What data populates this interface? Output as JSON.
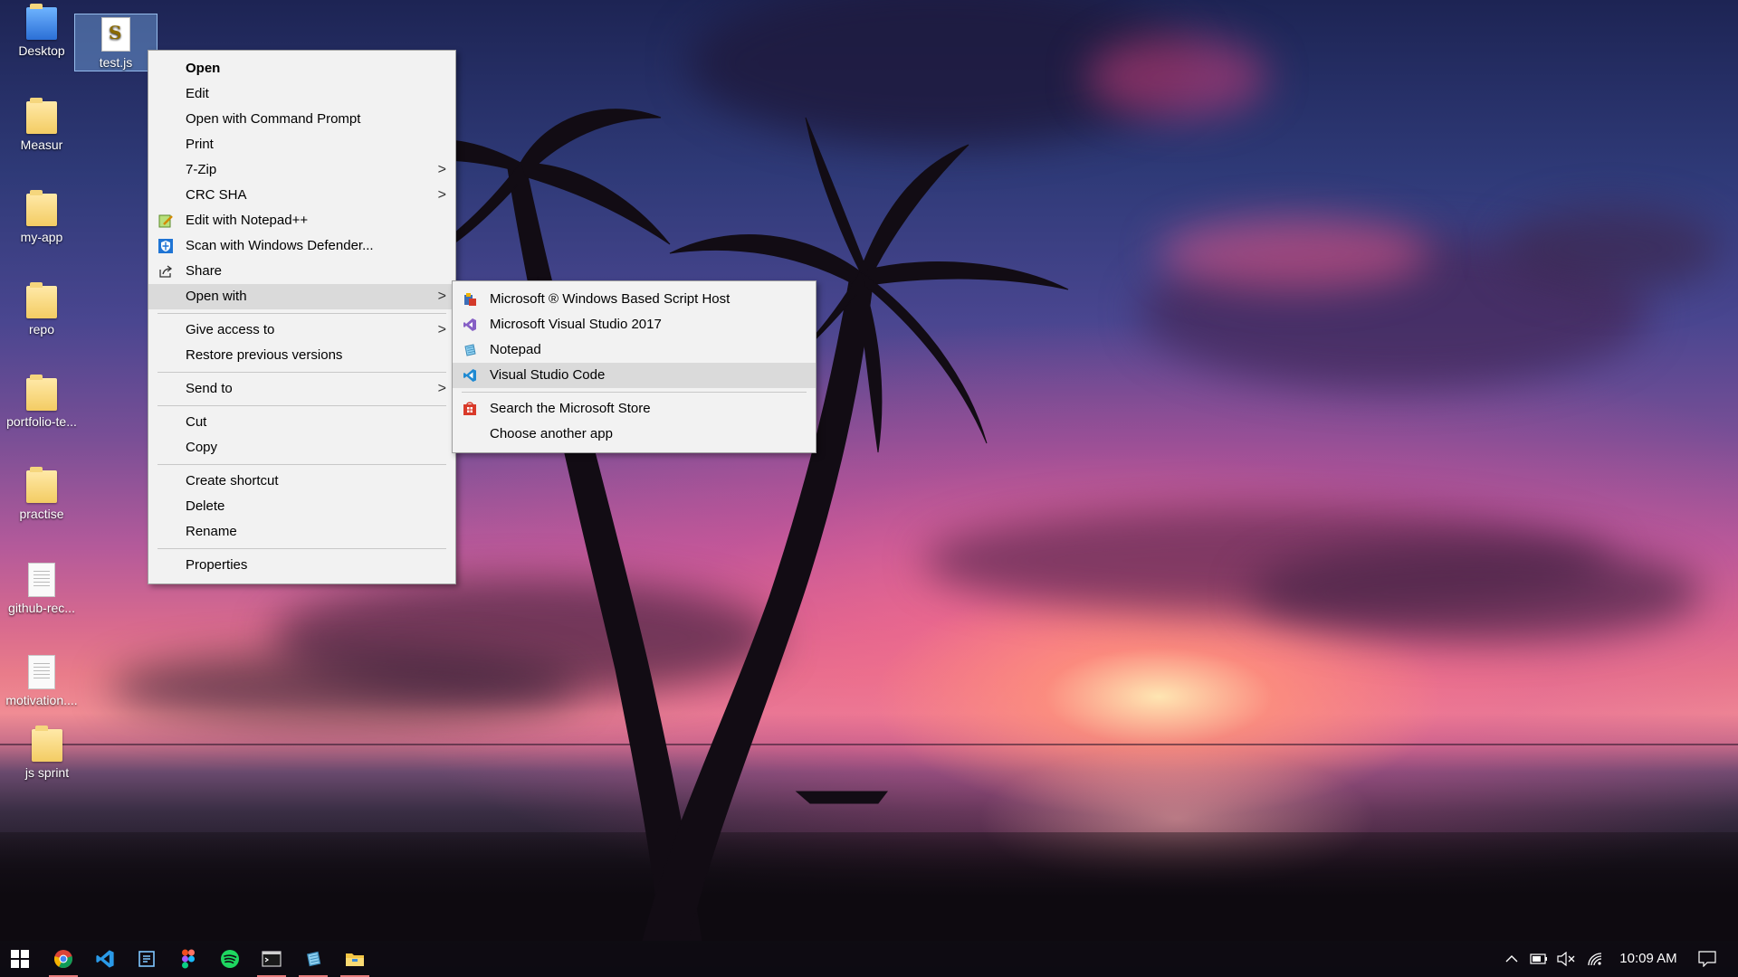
{
  "desktop": {
    "icons": [
      {
        "label": "Desktop"
      },
      {
        "label": "test.js"
      },
      {
        "label": "Measur"
      },
      {
        "label": "my-app"
      },
      {
        "label": "repo"
      },
      {
        "label": "portfolio-te..."
      },
      {
        "label": "practise"
      },
      {
        "label": "github-rec..."
      },
      {
        "label": "motivation...."
      },
      {
        "label": "js sprint"
      }
    ]
  },
  "context_menu": {
    "items": [
      {
        "label": "Open"
      },
      {
        "label": "Edit"
      },
      {
        "label": "Open with Command Prompt"
      },
      {
        "label": "Print"
      },
      {
        "label": "7-Zip"
      },
      {
        "label": "CRC SHA"
      },
      {
        "label": "Edit with Notepad++"
      },
      {
        "label": "Scan with Windows Defender..."
      },
      {
        "label": "Share"
      },
      {
        "label": "Open with"
      },
      {
        "label": "Give access to"
      },
      {
        "label": "Restore previous versions"
      },
      {
        "label": "Send to"
      },
      {
        "label": "Cut"
      },
      {
        "label": "Copy"
      },
      {
        "label": "Create shortcut"
      },
      {
        "label": "Delete"
      },
      {
        "label": "Rename"
      },
      {
        "label": "Properties"
      }
    ],
    "submenu_arrow": ">"
  },
  "open_with_menu": {
    "items": [
      {
        "label": "Microsoft ® Windows Based Script Host",
        "icon": "script-host-icon"
      },
      {
        "label": "Microsoft Visual Studio 2017",
        "icon": "visual-studio-icon"
      },
      {
        "label": "Notepad",
        "icon": "notepad-icon"
      },
      {
        "label": "Visual Studio Code",
        "icon": "vscode-icon"
      },
      {
        "label": "Search the Microsoft Store",
        "icon": "store-icon"
      },
      {
        "label": "Choose another app"
      }
    ]
  },
  "taskbar": {
    "apps": [
      "start-icon",
      "chrome-icon",
      "vscode-icon",
      "app-icon",
      "figma-icon",
      "spotify-icon",
      "terminal-icon",
      "notepad-icon",
      "file-explorer-icon"
    ],
    "clock": "10:09 AM"
  },
  "colors": {
    "menu_bg": "#f2f2f2",
    "menu_highlight": "#dadada",
    "taskbar_bg": "#0e0c12",
    "taskbar_active_underline": "#e67b7b"
  }
}
